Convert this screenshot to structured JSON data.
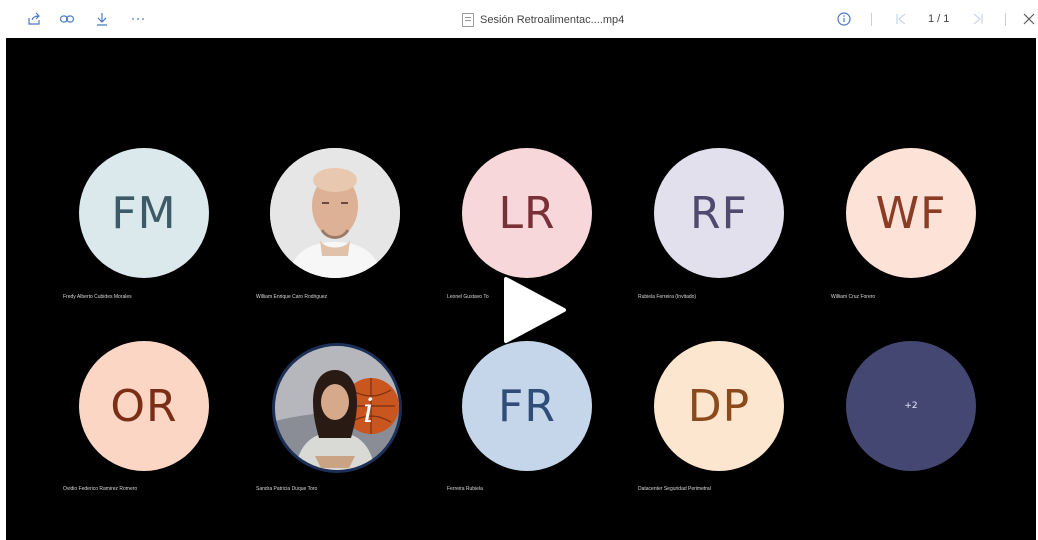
{
  "toolbar": {
    "icons": [
      "share-icon",
      "link-icon",
      "download-icon",
      "more-icon",
      "info-icon",
      "first-page-icon",
      "last-page-icon",
      "close-icon"
    ],
    "file_name": "Sesión Retroalimentac....mp4",
    "page_indicator": "1 / 1"
  },
  "colors": {
    "icon_blue": "#4a78c2",
    "video_bg": "#000000"
  },
  "participants": [
    {
      "initials": "FM",
      "name": "Fredy Alberto Cubides Morales",
      "bg": "#dbe8ec",
      "fg": "#3c5b66"
    },
    {
      "initials": "",
      "name": "William Enrique Caro Rodriguez",
      "photo": "man-photo"
    },
    {
      "initials": "LR",
      "name": "Leonel Gustavo To",
      "bg": "#f7d7da",
      "fg": "#7a3038"
    },
    {
      "initials": "RF",
      "name": "Rubiela Ferreira (Invitado)",
      "bg": "#e3e0ee",
      "fg": "#514a70"
    },
    {
      "initials": "WF",
      "name": "William Cruz Forero",
      "bg": "#fde2d8",
      "fg": "#8a3c25"
    },
    {
      "initials": "OR",
      "name": "Ovidio Federico Ramirez Romero",
      "bg": "#fbd6c5",
      "fg": "#7a2e16"
    },
    {
      "initials": "",
      "name": "Sandra Patricia Duque Toro",
      "photo": "woman-photo"
    },
    {
      "initials": "FR",
      "name": "Ferreira Rubiela",
      "bg": "#c6d6ea",
      "fg": "#2f4d78"
    },
    {
      "initials": "DP",
      "name": "Datacenter Seguridad Perimetral",
      "bg": "#fde6cf",
      "fg": "#8a4a1c"
    }
  ],
  "overflow_count": "+2",
  "overflow_bg": "#454773"
}
